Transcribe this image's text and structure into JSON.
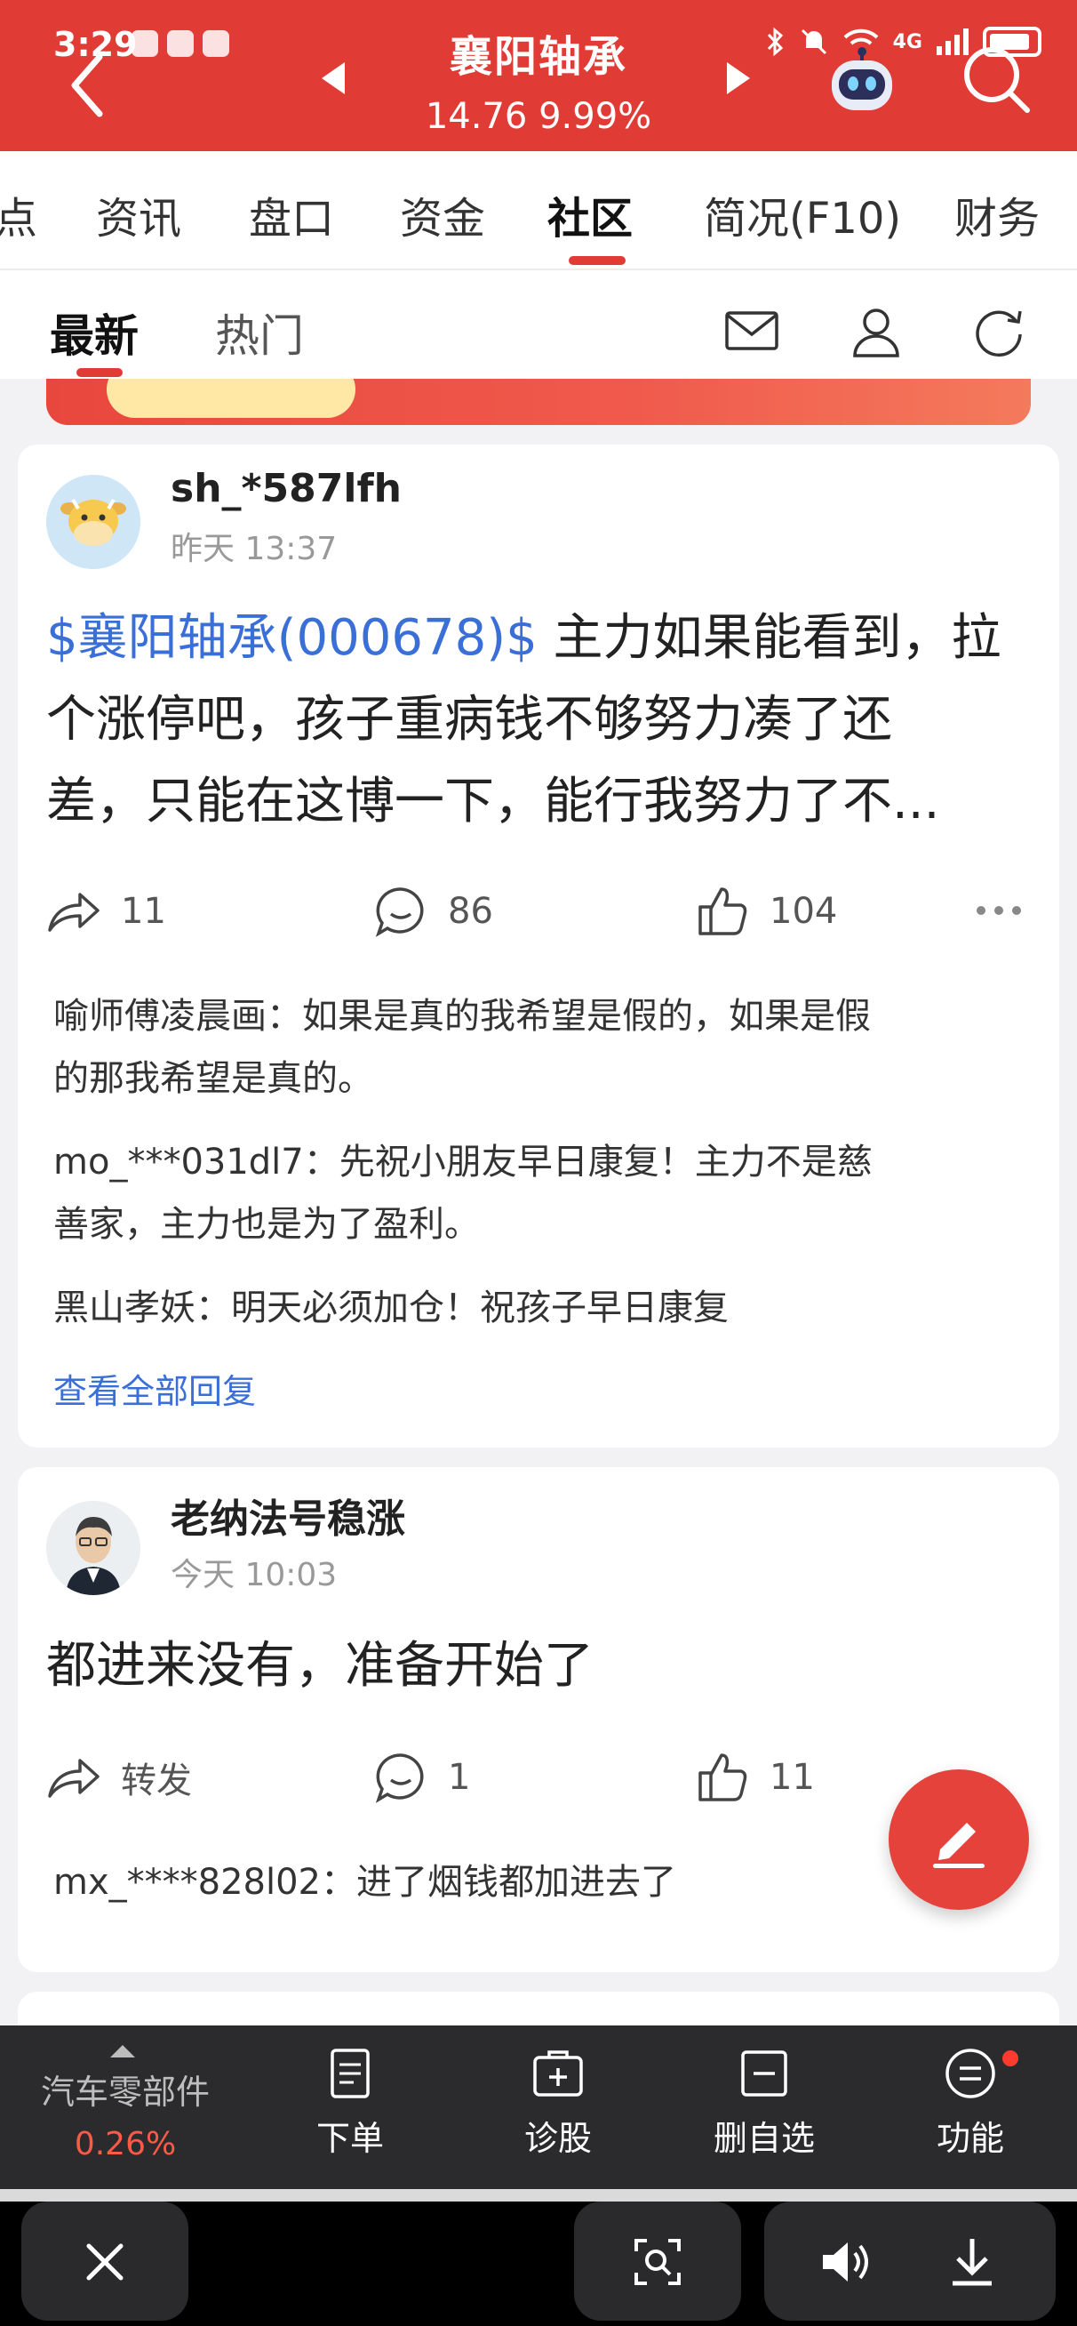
{
  "status_bar": {
    "time": "3:29",
    "network": "4G"
  },
  "header": {
    "stock_name": "襄阳轴承",
    "price": "14.76",
    "change_pct": "9.99%"
  },
  "tabs": [
    "点",
    "资讯",
    "盘口",
    "资金",
    "社区",
    "简况(F10)",
    "财务"
  ],
  "active_tab": "社区",
  "sub_tabs": [
    "最新",
    "热门"
  ],
  "posts": [
    {
      "username": "sh_*587lfh",
      "time": "昨天 13:37",
      "stock_tag": "$襄阳轴承(000678)$",
      "text_line1": " 主力如果能看到，拉",
      "text_line2": "个涨停吧，孩子重病钱不够努力凑了还",
      "text_line3": "差，只能在这博一下，能行我努力了不...",
      "shares": "11",
      "comments": "86",
      "likes": "104",
      "replies": [
        {
          "line1": "喻师傅凌晨画：如果是真的我希望是假的，如果是假",
          "line2": "的那我希望是真的。"
        },
        {
          "line1": "mo_***031dl7：先祝小朋友早日康复！主力不是慈",
          "line2": "善家，主力也是为了盈利。"
        },
        {
          "line1": "黑山孝妖：明天必须加仓！祝孩子早日康复",
          "line2": ""
        }
      ],
      "view_all": "查看全部回复"
    },
    {
      "username": "老纳法号稳涨",
      "time": "今天 10:03",
      "text": "都进来没有，准备开始了",
      "shares": "转发",
      "comments": "1",
      "likes": "11",
      "replies": [
        {
          "line1": "mx_****828l02：进了烟钱都加进去了"
        }
      ]
    }
  ],
  "bottom_bar": {
    "sector_name": "汽车零部件",
    "sector_pct": "0.26%",
    "items": [
      "下单",
      "诊股",
      "删自选",
      "功能"
    ]
  },
  "colors": {
    "brand_red": "#e13b36",
    "link_blue": "#3a6fd8",
    "up_red": "#ff5a47"
  }
}
